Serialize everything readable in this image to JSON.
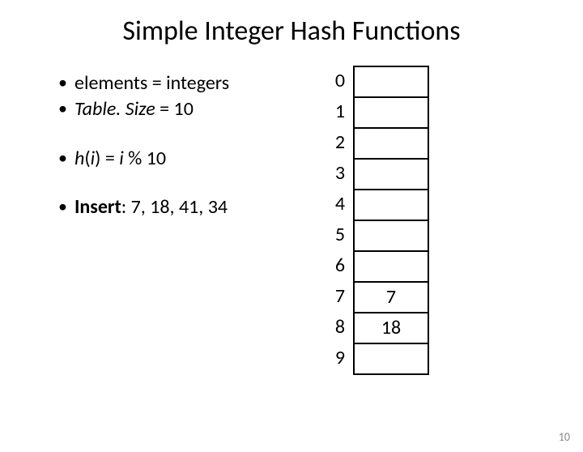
{
  "title": "Simple Integer Hash Functions",
  "bullets": {
    "b1_pre": "elements = integers",
    "b2_pre": "Table. Size",
    "b2_post": " = 10",
    "b3_pre": "h",
    "b3_arg": "i",
    "b3_mid": ") = ",
    "b3_var": "i",
    "b3_post": " % 10",
    "b4_label": "Insert",
    "b4_rest": ": 7, 18, 41, 34"
  },
  "table": {
    "indices": [
      "0",
      "1",
      "2",
      "3",
      "4",
      "5",
      "6",
      "7",
      "8",
      "9"
    ],
    "cells": [
      "",
      "",
      "",
      "",
      "",
      "",
      "",
      "7",
      "18",
      ""
    ]
  },
  "pageno": "10"
}
